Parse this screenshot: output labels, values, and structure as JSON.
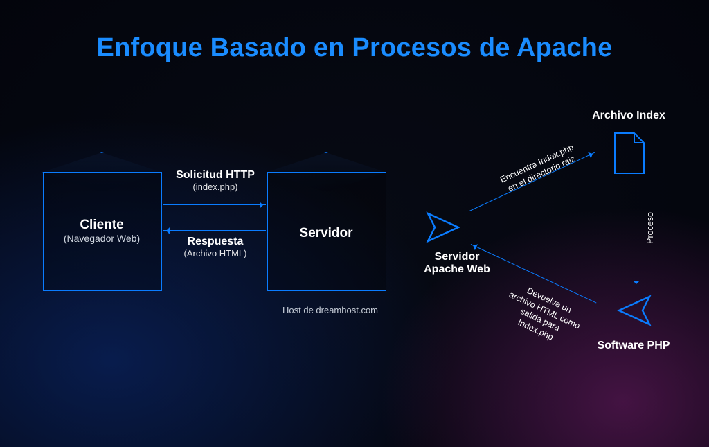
{
  "title": "Enfoque Basado en Procesos de Apache",
  "client": {
    "title": "Cliente",
    "subtitle": "(Navegador Web)"
  },
  "server": {
    "title": "Servidor",
    "caption": "Host de dreamhost.com"
  },
  "request": {
    "title": "Solicitud HTTP",
    "subtitle": "(index.php)"
  },
  "response": {
    "title": "Respuesta",
    "subtitle": "(Archivo HTML)"
  },
  "apacheLabel": {
    "title": "Servidor",
    "subtitle": "Apache Web"
  },
  "indexFile": {
    "title": "Archivo Index"
  },
  "phpLabel": {
    "title": "Software PHP"
  },
  "findText": "Encuentra Index.php\nen el directorio raiz",
  "returnText": "Devuelve un\narchivo HTML como\nsalida para\nIndex.php",
  "processText": "Proceso",
  "colors": {
    "blue": "#0a7cff",
    "white": "#ffffff"
  }
}
